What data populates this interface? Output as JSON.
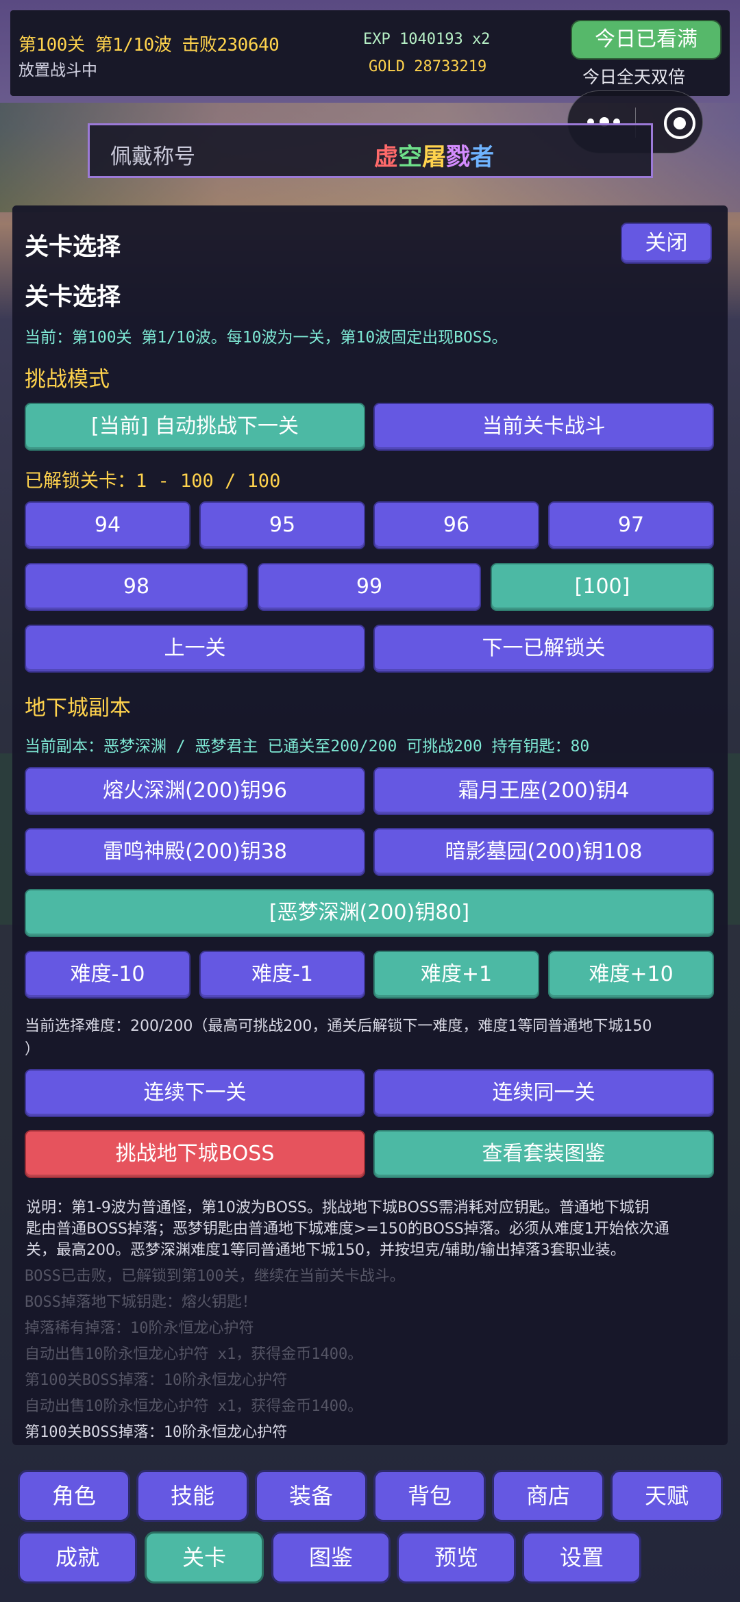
{
  "top_bar": {
    "stage_info": "第100关 第1/10波  击败230640",
    "idle_status": "放置战斗中",
    "exp": "EXP 1040193 x2",
    "gold": "GOLD 28733219",
    "watched_button": "今日已看满",
    "double_status": "今日全天双倍"
  },
  "title_bar": {
    "label": "佩戴称号",
    "value_chars": [
      "虚",
      "空",
      "屠",
      "戮",
      "者"
    ],
    "value_colors": [
      "#ff6a6a",
      "#6fe08a",
      "#ffd34d",
      "#d58cff",
      "#6fb4ff"
    ]
  },
  "panel": {
    "header_title": "关卡选择",
    "close_label": "关闭",
    "section_title": "关卡选择",
    "current_info": "当前：第100关 第1/10波。每10波为一关，第10波固定出现BOSS。",
    "mode_title": "挑战模式",
    "mode_buttons": [
      "[当前] 自动挑战下一关",
      "当前关卡战斗"
    ],
    "unlocked_text": "已解锁关卡：1 - 100 / 100",
    "level_row1": [
      "94",
      "95",
      "96",
      "97"
    ],
    "level_row2": [
      "98",
      "99",
      "[100]"
    ],
    "prev_level": "上一关",
    "next_unlocked": "下一已解锁关",
    "dungeon_title": "地下城副本",
    "dungeon_info": "当前副本：恶梦深渊 / 恶梦君主  已通关至200/200  可挑战200  持有钥匙：80",
    "dungeons": [
      "熔火深渊(200)钥96",
      "霜月王座(200)钥4",
      "雷鸣神殿(200)钥38",
      "暗影墓园(200)钥108",
      "[恶梦深渊(200)钥80]"
    ],
    "difficulty_buttons": [
      "难度-10",
      "难度-1",
      "难度+1",
      "难度+10"
    ],
    "difficulty_info_line1": "当前选择难度：200/200（最高可挑战200，通关后解锁下一难度，难度1等同普通地下城150",
    "difficulty_info_line2": "）",
    "continue_next": "连续下一关",
    "continue_same": "连续同一关",
    "challenge_boss": "挑战地下城BOSS",
    "view_sets": "查看套装图鉴",
    "note_lines": [
      "说明：第1-9波为普通怪，第10波为BOSS。挑战地下城BOSS需消耗对应钥匙。普通地下城钥",
      "匙由普通BOSS掉落；恶梦钥匙由普通地下城难度>=150的BOSS掉落。必须从难度1开始依次通",
      "关，最高200。恶梦深渊难度1等同普通地下城150，并按坦克/辅助/输出掉落3套职业装。"
    ],
    "log_lines": [
      "BOSS已击败，已解锁到第100关，继续在当前关卡战斗。",
      "BOSS掉落地下城钥匙：熔火钥匙！",
      "掉落稀有掉落：10阶永恒龙心护符",
      "自动出售10阶永恒龙心护符 x1，获得金币1400。",
      "第100关BOSS掉落：10阶永恒龙心护符",
      "自动出售10阶永恒龙心护符 x1，获得金币1400。",
      "第100关BOSS掉落：10阶永恒龙心护符"
    ]
  },
  "nav_row1": [
    "角色",
    "技能",
    "装备",
    "背包",
    "商店",
    "天赋"
  ],
  "nav_row2": [
    "成就",
    "关卡",
    "图鉴",
    "预览",
    "设置"
  ]
}
